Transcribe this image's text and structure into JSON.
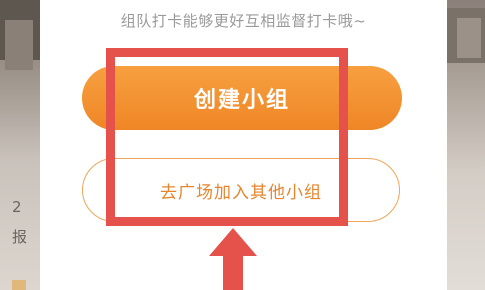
{
  "dialog": {
    "hint": "组队打卡能够更好互相监督打卡哦~",
    "create_button": "创建小组",
    "join_button": "去广场加入其他小组"
  },
  "background": {
    "left_text_1": "2",
    "left_text_2": "报"
  },
  "colors": {
    "accent": "#ef8626",
    "highlight": "#e5524b"
  }
}
